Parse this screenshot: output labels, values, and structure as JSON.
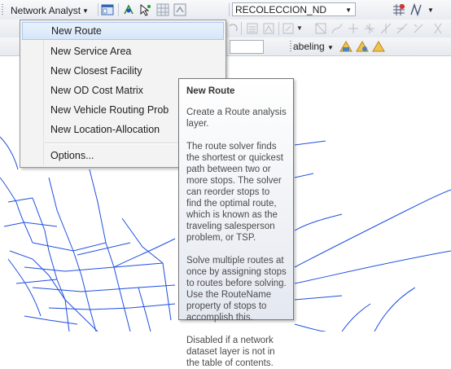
{
  "toolbar": {
    "network_analyst_label": "Network Analyst",
    "layer_combo_value": "RECOLECCION_ND",
    "labeling_label": "abeling"
  },
  "menu": {
    "items": [
      {
        "label": "New Route"
      },
      {
        "label": "New Service Area"
      },
      {
        "label": "New Closest Facility"
      },
      {
        "label": "New OD Cost Matrix"
      },
      {
        "label": "New Vehicle Routing Prob"
      },
      {
        "label": "New Location-Allocation"
      }
    ],
    "options_label": "Options..."
  },
  "tooltip": {
    "title": "New Route",
    "paragraphs": [
      "Create a Route analysis layer.",
      "The route solver finds the shortest or quickest path between two or more stops. The solver can reorder stops to find the optimal route, which is known as the traveling salesperson problem, or TSP.",
      "Solve multiple routes at once by assigning stops to routes before solving. Use the RouteName property of stops to accomplish this.",
      "Disabled if a network dataset layer is not in the table of contents."
    ]
  },
  "colors": {
    "road": "#1f4fe0",
    "menu_highlight": "#d6e6f9",
    "toolbar_bg": "#e8ebf0"
  }
}
